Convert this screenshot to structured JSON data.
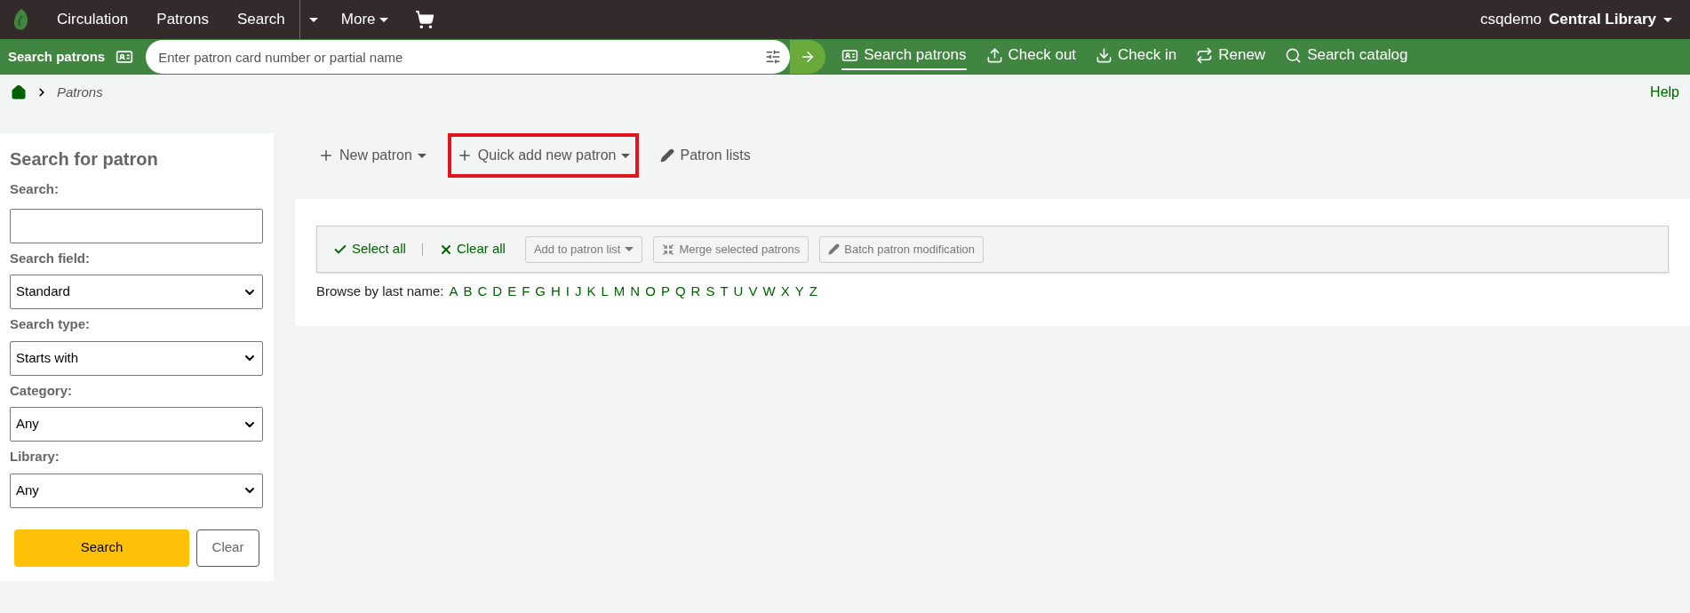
{
  "top_nav": {
    "items": [
      {
        "label": "Circulation",
        "kind": "link"
      },
      {
        "label": "Patrons",
        "kind": "link"
      },
      {
        "label": "Search",
        "kind": "split"
      },
      {
        "label": "More",
        "kind": "dropdown"
      }
    ],
    "user": "csqdemo",
    "library": "Central Library"
  },
  "search_bar": {
    "label": "Search patrons",
    "placeholder": "Enter patron card number or partial name",
    "tabs": [
      {
        "label": "Search patrons",
        "selected": true,
        "kind": "card"
      },
      {
        "label": "Check out",
        "selected": false,
        "kind": "upload"
      },
      {
        "label": "Check in",
        "selected": false,
        "kind": "download"
      },
      {
        "label": "Renew",
        "selected": false,
        "kind": "renew"
      },
      {
        "label": "Search catalog",
        "selected": false,
        "kind": "search"
      }
    ]
  },
  "breadcrumb": {
    "current": "Patrons"
  },
  "help": "Help",
  "sidebar": {
    "title": "Search for patron",
    "search_label": "Search:",
    "selects": [
      {
        "label": "Search field:",
        "value": "Standard"
      },
      {
        "label": "Search type:",
        "value": "Starts with"
      },
      {
        "label": "Category:",
        "value": "Any"
      },
      {
        "label": "Library:",
        "value": "Any"
      }
    ],
    "search_button": "Search",
    "clear_button": "Clear"
  },
  "actions": [
    {
      "label": "New patron",
      "kind": "plus",
      "dropdown": true,
      "highlighted": false
    },
    {
      "label": "Quick add new patron",
      "kind": "plus",
      "dropdown": true,
      "highlighted": true
    },
    {
      "label": "Patron lists",
      "kind": "pencil",
      "dropdown": false,
      "highlighted": false
    }
  ],
  "batch_toolbar": {
    "select_all": "Select all",
    "clear_all": "Clear all",
    "buttons": [
      {
        "label": "Add to patron list",
        "kind": "dropdown"
      },
      {
        "label": "Merge selected patrons",
        "kind": "merge"
      },
      {
        "label": "Batch patron modification",
        "kind": "pencil"
      }
    ]
  },
  "browse": {
    "label": "Browse by last name:",
    "letters": [
      "A",
      "B",
      "C",
      "D",
      "E",
      "F",
      "G",
      "H",
      "I",
      "J",
      "K",
      "L",
      "M",
      "N",
      "O",
      "P",
      "Q",
      "R",
      "S",
      "T",
      "U",
      "V",
      "W",
      "X",
      "Y",
      "Z"
    ]
  }
}
